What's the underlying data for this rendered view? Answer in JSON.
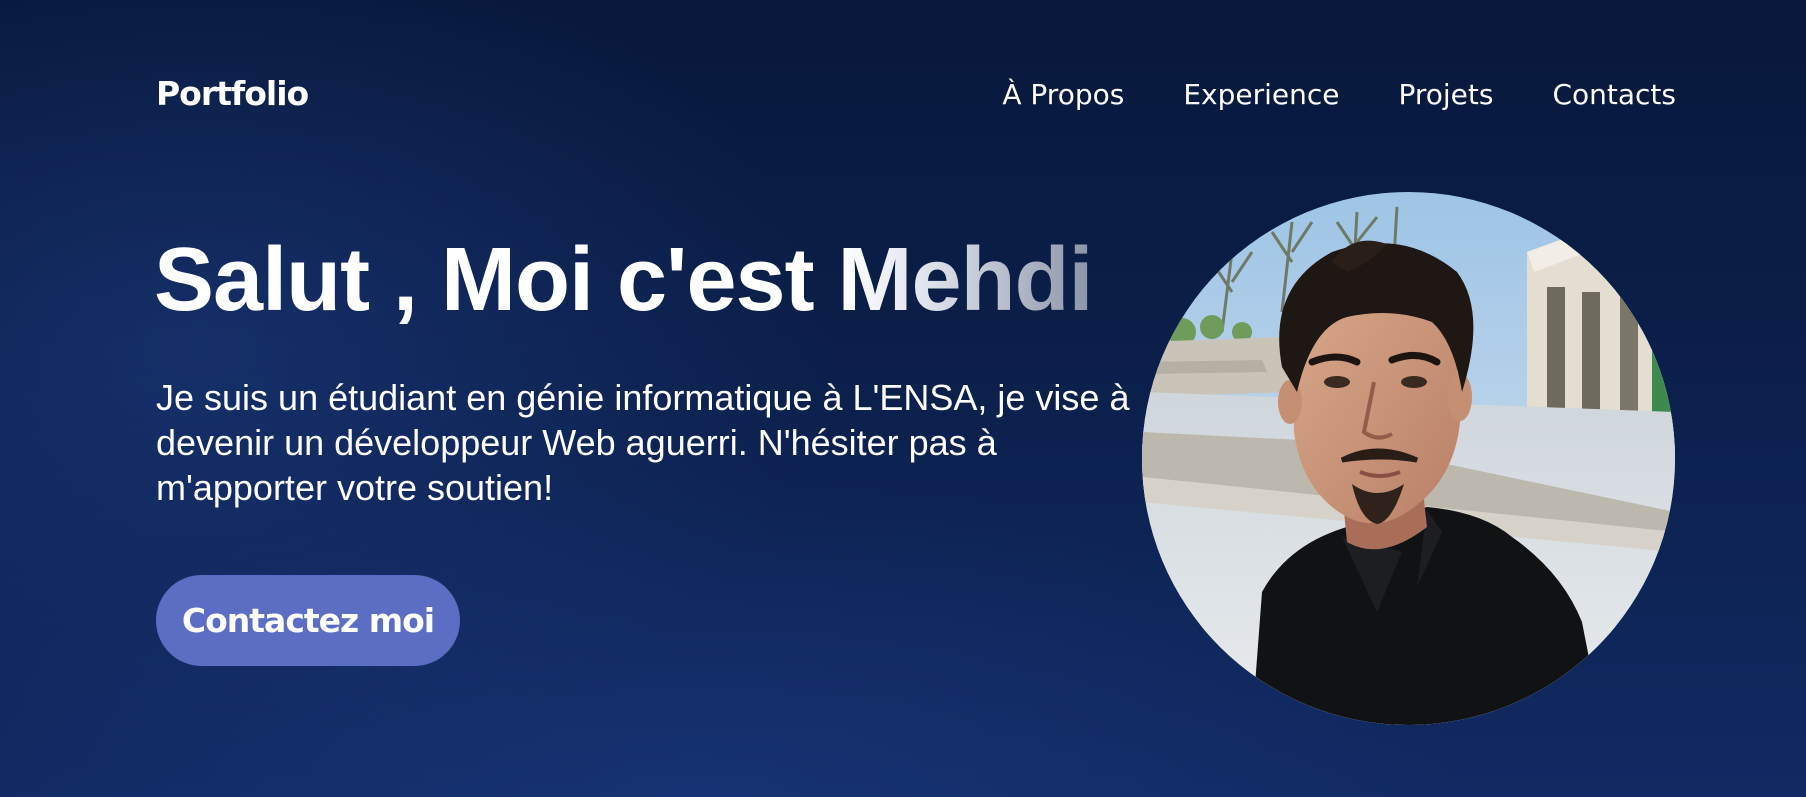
{
  "header": {
    "logo": "Portfolio",
    "nav": [
      {
        "label": "À Propos"
      },
      {
        "label": "Experience"
      },
      {
        "label": "Projets"
      },
      {
        "label": "Contacts"
      }
    ]
  },
  "hero": {
    "title_prefix": "Salut , Moi c'est ",
    "title_name": "Mehdi",
    "description": "Je suis un étudiant en génie informatique à L'ENSA, je vise à devenir un développeur Web aguerri. N'hésiter pas à m'apporter votre soutien!",
    "cta_label": "Contactez moi"
  },
  "colors": {
    "background": "#0b1f4a",
    "accent": "#5b6ec4",
    "text": "#ffffff"
  }
}
